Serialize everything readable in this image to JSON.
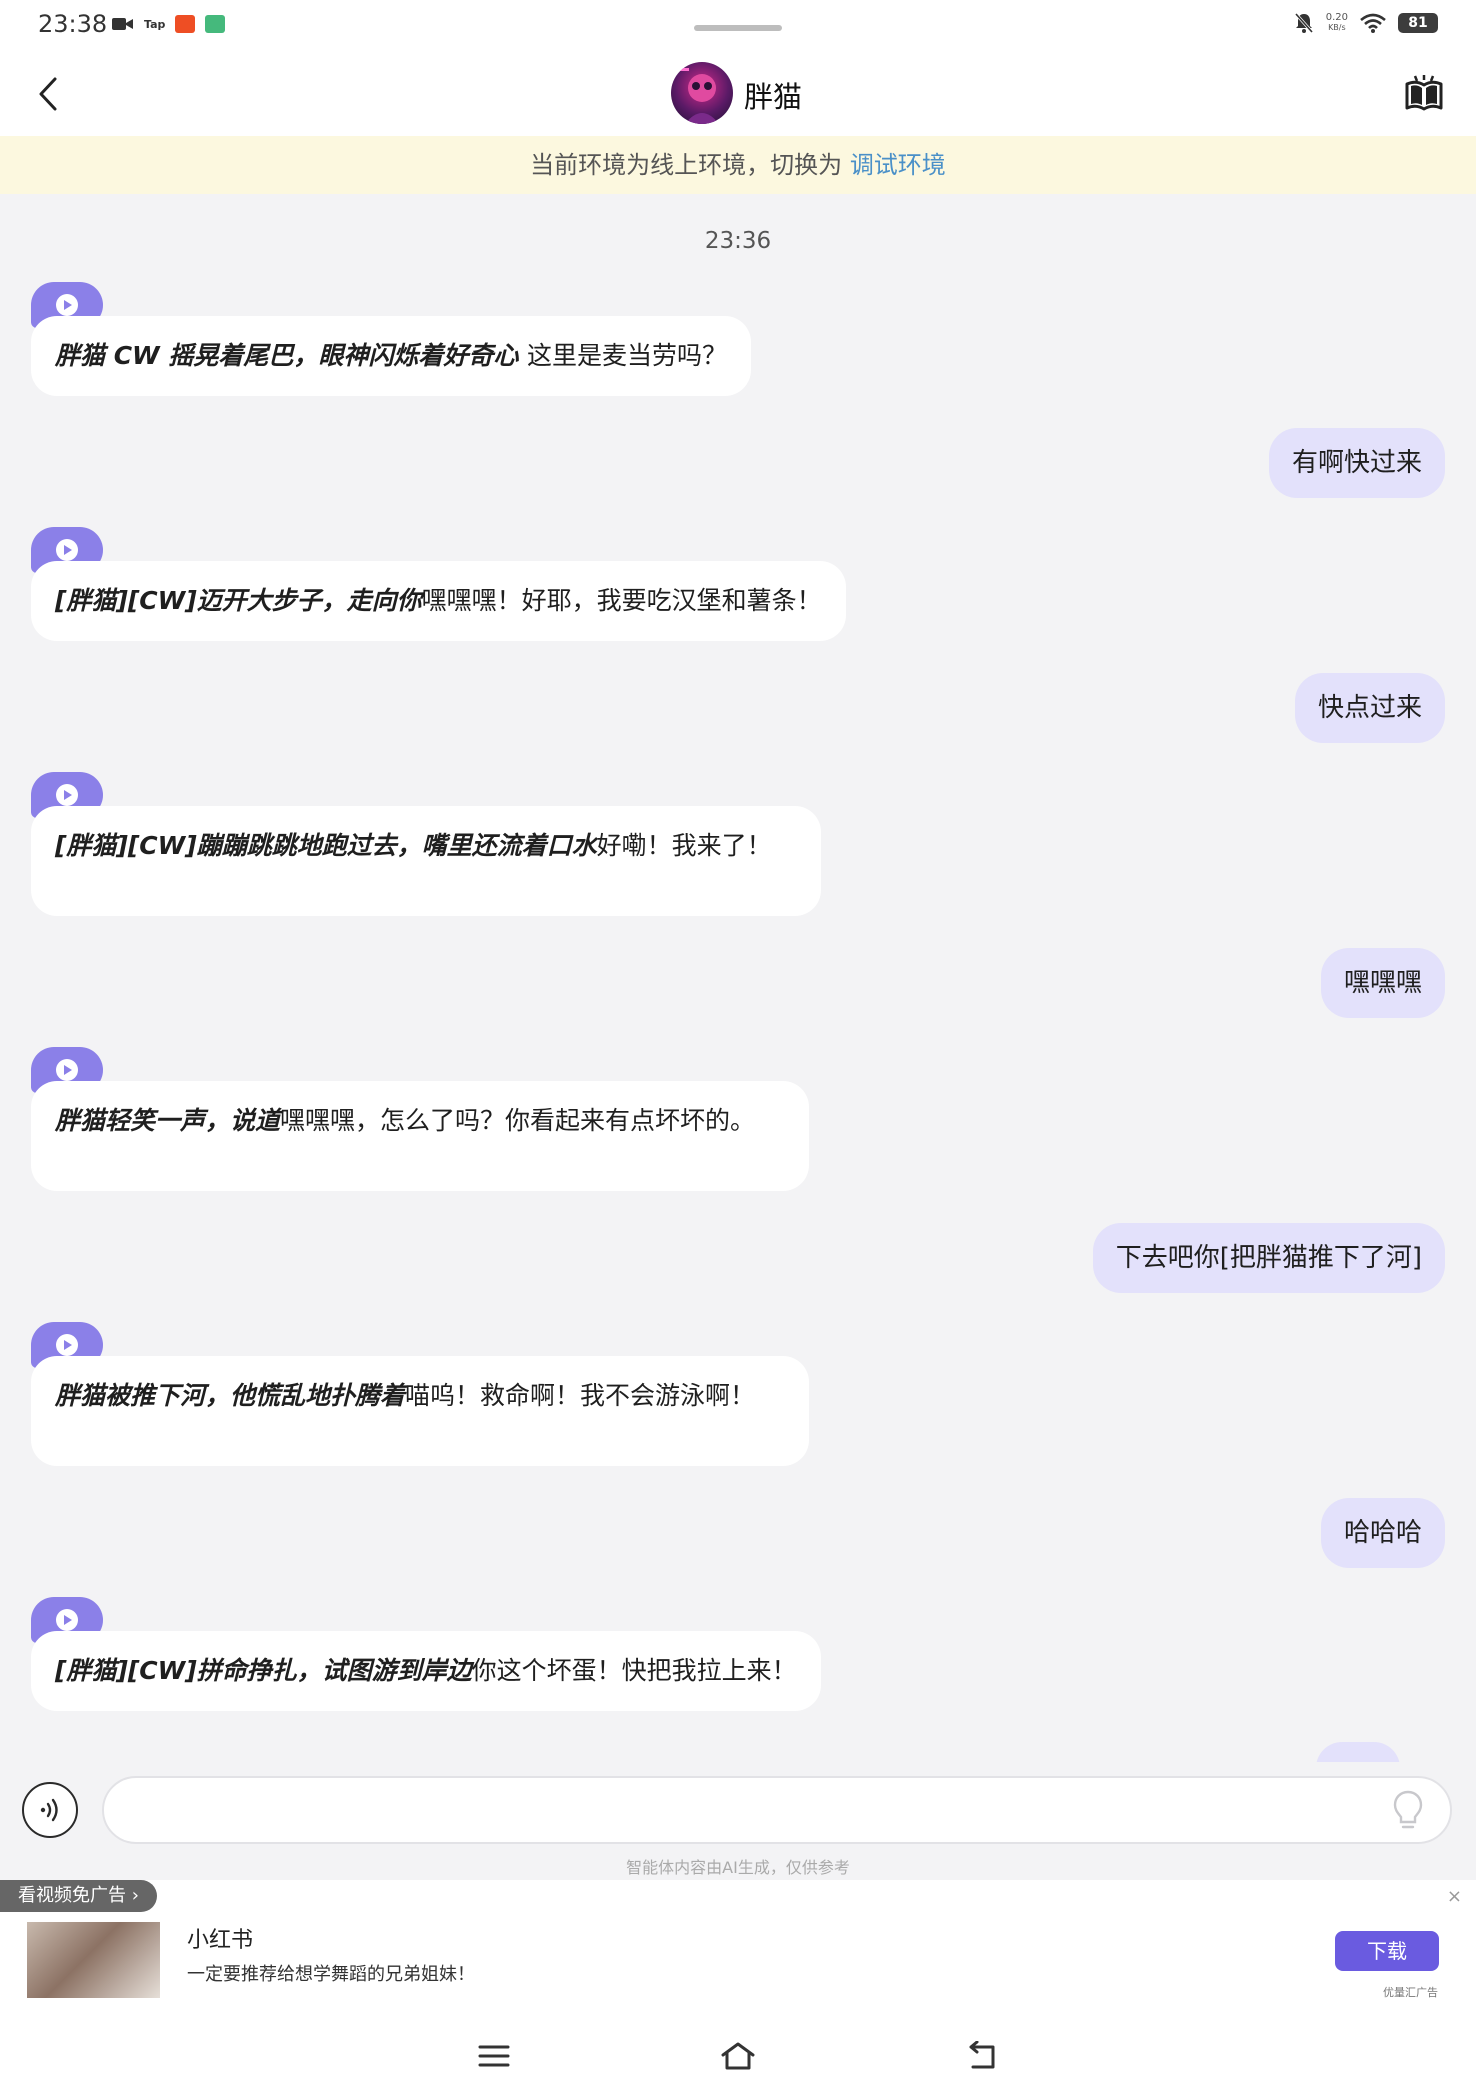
{
  "status_bar": {
    "time": "23:38",
    "net_speed_value": "0.20",
    "net_speed_unit": "KB/s",
    "battery": "81"
  },
  "header": {
    "title": "胖猫"
  },
  "env_notice": {
    "text": "当前环境为线上环境，切换为 ",
    "link": "调试环境"
  },
  "chat": {
    "time_label": "23:36",
    "messages": [
      {
        "role": "ai",
        "action": "胖猫  CW  摇晃着尾巴，眼神闪烁着好奇心 ",
        "text": " 这里是麦当劳吗？"
      },
      {
        "role": "user",
        "text": "有啊快过来"
      },
      {
        "role": "ai",
        "action": "[胖猫][CW]迈开大步子，走向你",
        "text": "嘿嘿嘿！好耶，我要吃汉堡和薯条！"
      },
      {
        "role": "user",
        "text": "快点过来"
      },
      {
        "role": "ai",
        "action": "[胖猫][CW]蹦蹦跳跳地跑过去，嘴里还流着口水",
        "text": "好嘞！我来了！"
      },
      {
        "role": "user",
        "text": "嘿嘿嘿"
      },
      {
        "role": "ai",
        "action": "胖猫轻笑一声，说道",
        "text": "嘿嘿嘿，怎么了吗？你看起来有点坏坏的。"
      },
      {
        "role": "user",
        "text": "下去吧你[把胖猫推下了河]"
      },
      {
        "role": "ai",
        "action": "胖猫被推下河，他慌乱地扑腾着",
        "text": "喵呜！救命啊！我不会游泳啊！"
      },
      {
        "role": "user",
        "text": "哈哈哈"
      },
      {
        "role": "ai",
        "action": "[胖猫][CW]拼命挣扎，试图游到岸边",
        "text": "你这个坏蛋！快把我拉上来！"
      }
    ]
  },
  "input": {
    "placeholder": "",
    "disclaimer": "智能体内容由AI生成，仅供参考"
  },
  "ad": {
    "tag": "看视频免广告 ›",
    "close": "×",
    "name": "小红书",
    "description": "一定要推荐给想学舞蹈的兄弟姐妹！",
    "button": "下载",
    "brand": "优量汇广告"
  },
  "colors": {
    "accent": "#8b80e8",
    "user_bubble": "#e3e1fb",
    "link": "#4a90c8",
    "env_bg": "#fcf8df"
  }
}
